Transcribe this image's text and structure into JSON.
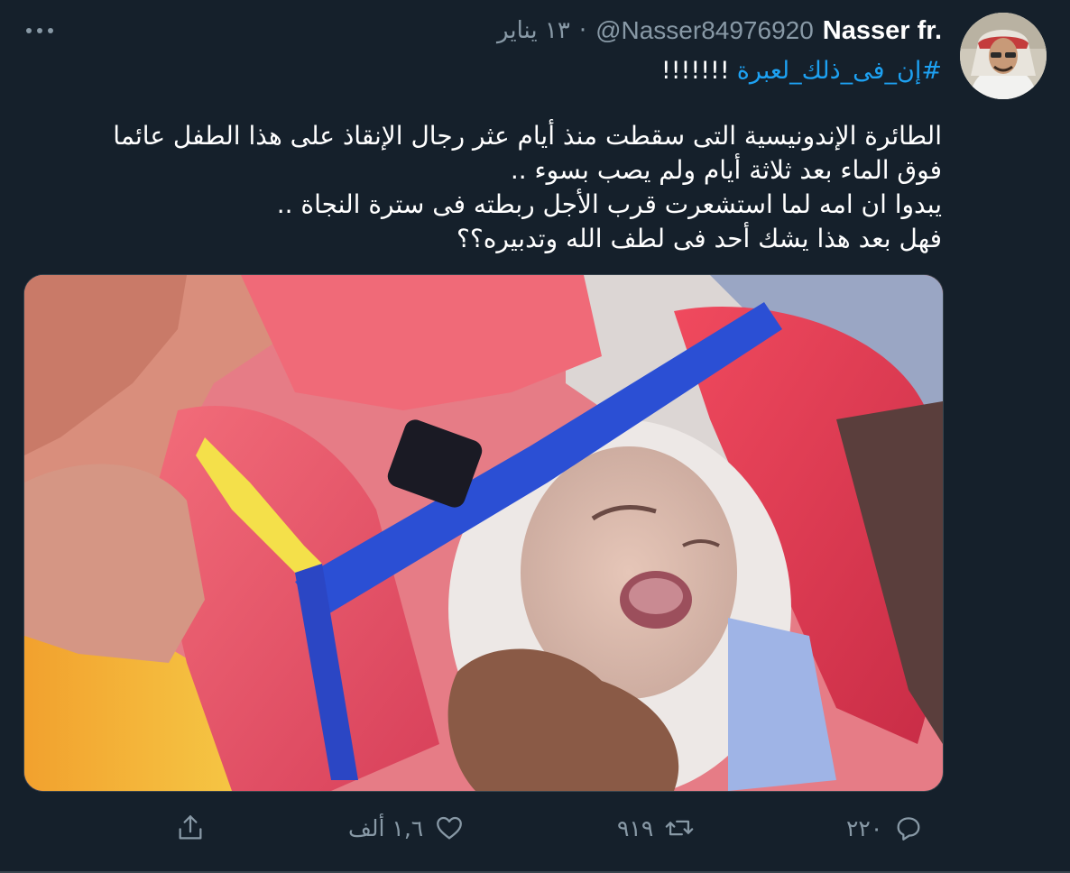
{
  "tweet": {
    "author": {
      "display_name": "Nasser fr.",
      "handle": "@Nasser84976920"
    },
    "separator": "·",
    "date": "١٣ يناير",
    "hashtag": "#إن_فى_ذلك_لعبرة",
    "exclamations": "!!!!!!!",
    "body_lines": [
      "الطائرة الإندونيسية التى سقطت منذ أيام عثر رجال الإنقاذ على هذا الطفل عائما",
      "فوق الماء بعد ثلاثة أيام ولم يصب بسوء ..",
      "يبدوا ان امه لما استشعرت قرب الأجل ربطته فى سترة النجاة ..",
      "فهل بعد هذا يشك أحد فى لطف الله وتدبيره؟؟"
    ],
    "actions": {
      "reply_count": "٢٢٠",
      "retweet_count": "٩١٩",
      "like_count": "١,٦ ألف"
    }
  },
  "icons": {
    "more": "more-horizontal-icon",
    "reply": "reply-icon",
    "retweet": "retweet-icon",
    "like": "heart-icon",
    "share": "share-icon"
  },
  "colors": {
    "background": "#15202b",
    "secondary_text": "#8899a6",
    "link": "#1da1f2",
    "border": "#38444d"
  }
}
